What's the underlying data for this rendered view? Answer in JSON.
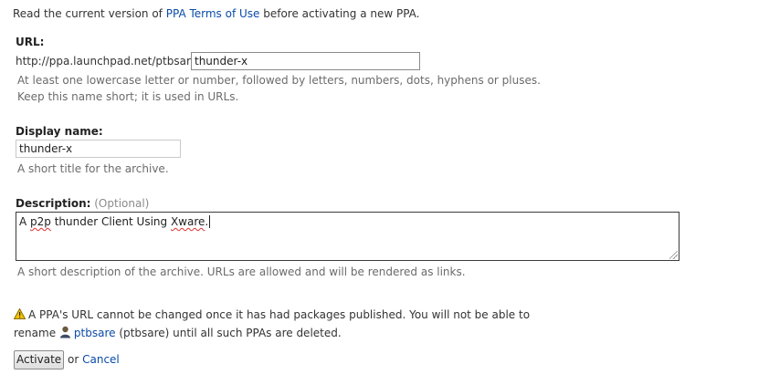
{
  "intro": {
    "prefix": "Read the current version of ",
    "terms_link": "PPA Terms of Use",
    "suffix": " before activating a new PPA."
  },
  "url_field": {
    "label": "URL:",
    "prefix": "http://ppa.launchpad.net/ptbsare/",
    "value": "thunder-x",
    "help_line1": "At least one lowercase letter or number, followed by letters, numbers, dots, hyphens or pluses.",
    "help_line2": "Keep this name short; it is used in URLs."
  },
  "display_name": {
    "label": "Display name:",
    "value": "thunder-x",
    "help": "A short title for the archive."
  },
  "description": {
    "label": "Description:",
    "optional": "(Optional)",
    "value_part1": "A ",
    "value_p2p": "p2p",
    "value_part2": " thunder Client Using ",
    "value_xware": "Xware",
    "value_part3": ".",
    "help": "A short description of the archive. URLs are allowed and will be rendered as links."
  },
  "warning": {
    "line1": "A PPA's URL cannot be changed once it has had packages published. You will not be able to",
    "rename": "rename",
    "user_link": "ptbsare",
    "user_id": " (ptbsare)",
    "line2_suffix": " until all such PPAs are deleted."
  },
  "actions": {
    "activate_label": "Activate",
    "or_text": "or",
    "cancel_label": "Cancel"
  },
  "colors": {
    "link": "#0a4ba8",
    "warning": "#f2c200"
  }
}
